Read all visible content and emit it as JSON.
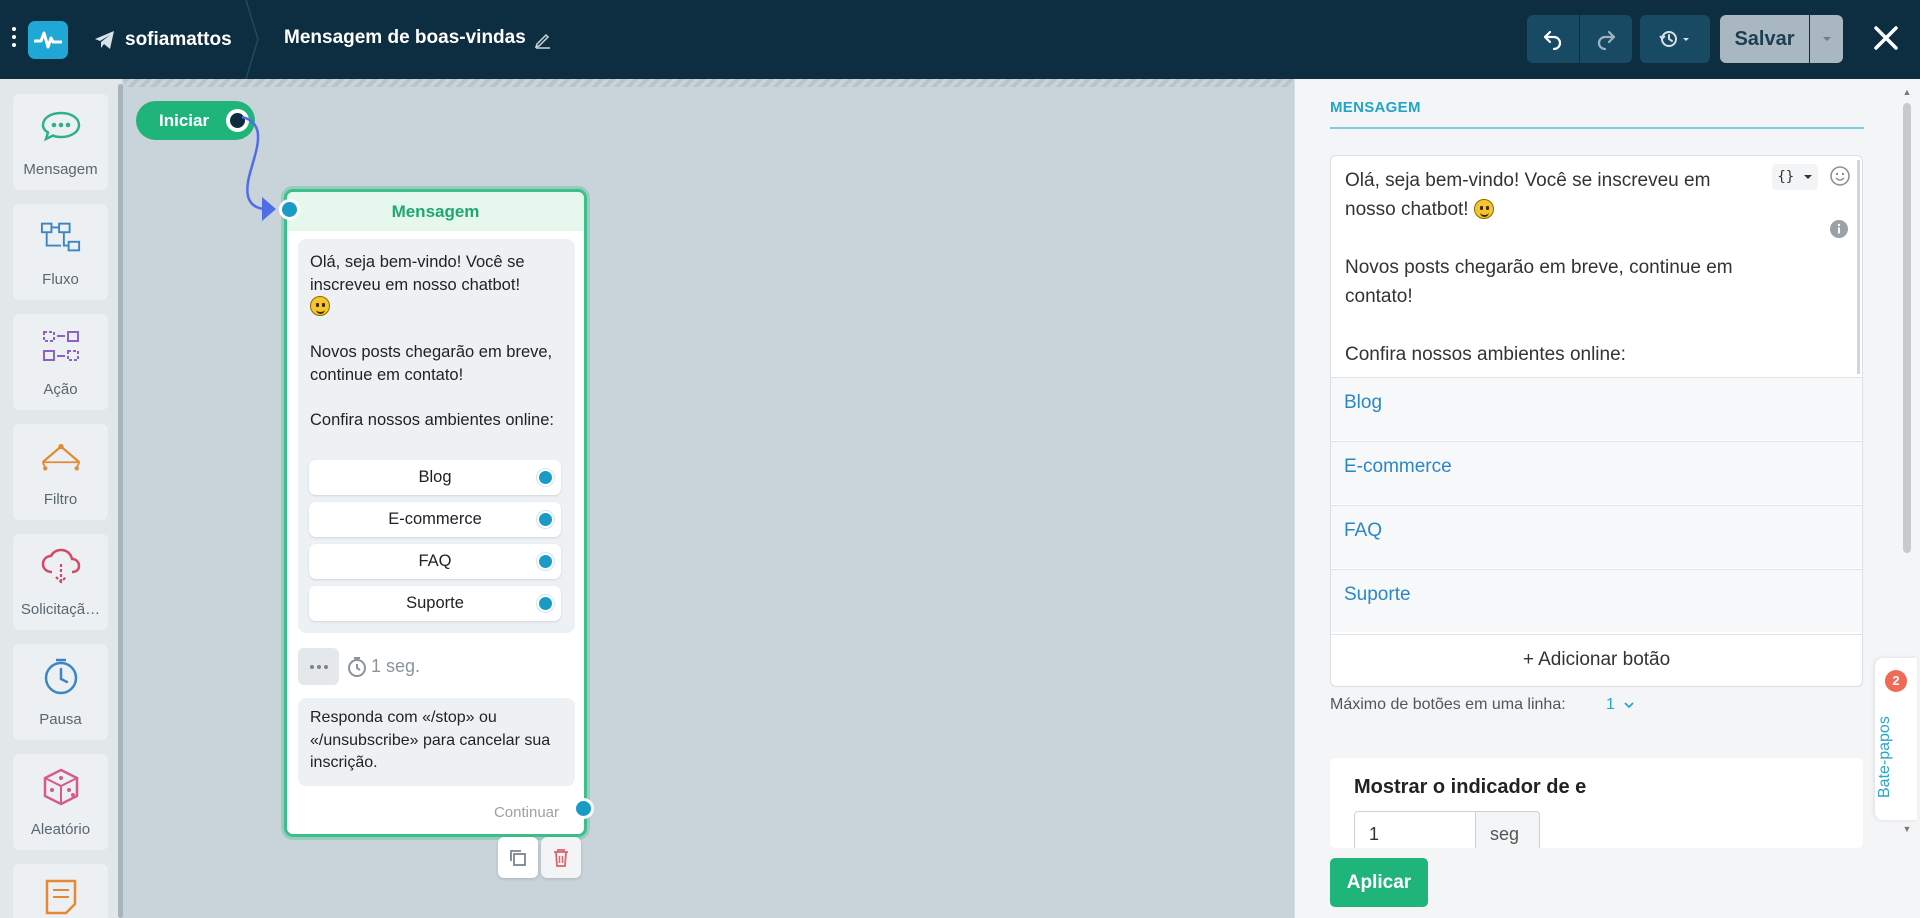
{
  "header": {
    "username": "sofiamattos",
    "flow_title": "Mensagem de boas-vindas",
    "save_label": "Salvar"
  },
  "palette": [
    {
      "label": "Mensagem",
      "icon": "chat-bubble-icon"
    },
    {
      "label": "Fluxo",
      "icon": "flow-icon"
    },
    {
      "label": "Ação",
      "icon": "action-icon"
    },
    {
      "label": "Filtro",
      "icon": "filter-icon"
    },
    {
      "label": "Solicitaçã…",
      "icon": "request-cloud-icon"
    },
    {
      "label": "Pausa",
      "icon": "clock-icon"
    },
    {
      "label": "Aleatório",
      "icon": "dice-icon"
    }
  ],
  "canvas": {
    "start_label": "Iniciar",
    "node": {
      "title": "Mensagem",
      "text_line1": "Olá, seja bem-vindo! Você se inscreveu em nosso chatbot!",
      "text_line2": "Novos posts chegarão em breve, continue em contato!",
      "text_line3": "Confira nossos ambientes online:",
      "buttons": [
        "Blog",
        "E-commerce",
        "FAQ",
        "Suporte"
      ],
      "delay": "1 seg.",
      "footer": "Responda com «/stop» ou «/unsubscribe» para cancelar sua inscrição.",
      "continue_label": "Continuar"
    }
  },
  "panel": {
    "tab_label": "MENSAGEM",
    "editor_line1": "Olá, seja bem-vindo! Você se inscreveu em nosso chatbot!",
    "editor_line2": "Novos posts chegarão em breve, continue em contato!",
    "editor_line3": "Confira nossos ambientes online:",
    "var_button": "{}",
    "buttons": [
      "Blog",
      "E-commerce",
      "FAQ",
      "Suporte"
    ],
    "add_button": "+ Adicionar botão",
    "max_buttons_label": "Máximo de botões em uma linha:",
    "max_buttons_value": "1",
    "typing_title": "Mostrar o indicador de e",
    "typing_value": "1",
    "typing_unit": "seg",
    "apply_label": "Aplicar"
  },
  "chats": {
    "label": "Bate-papos",
    "count": "2"
  },
  "colors": {
    "topbar": "#0d2d40",
    "accent_green": "#1fb47a",
    "accent_blue": "#1a9bc6",
    "link_blue": "#2b86c8"
  }
}
